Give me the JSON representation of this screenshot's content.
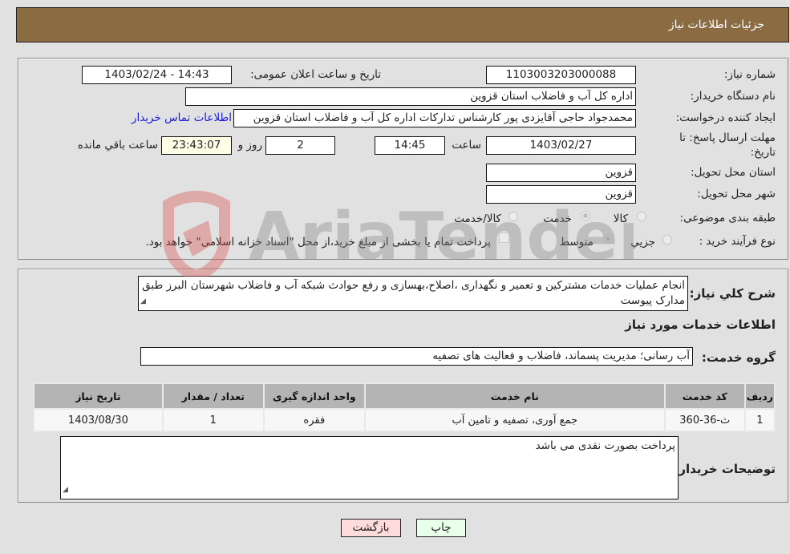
{
  "header": {
    "title": "جزئیات اطلاعات نیاز"
  },
  "details": {
    "need_number_label": "شماره نیاز:",
    "need_number": "1103003203000088",
    "announce_label": "تاریخ و ساعت اعلان عمومی:",
    "announce_value": "1403/02/24 - 14:43",
    "buyer_org_label": "نام دستگاه خریدار:",
    "buyer_org": "اداره کل آب و فاضلاب استان قزوین",
    "requester_label": "ایجاد کننده درخواست:",
    "requester": "محمدجواد حاجی آقایزدی پور کارشناس تدارکات اداره کل آب و فاضلاب استان قزوین",
    "contact_link": "اطلاعات تماس خریدار",
    "deadline_label": "مهلت ارسال پاسخ: تا تاریخ:",
    "deadline_date": "1403/02/27",
    "time_label": "ساعت",
    "deadline_time": "14:45",
    "days_value": "2",
    "days_label": "روز و",
    "remaining_time": "23:43:07",
    "remaining_label": "ساعت باقي مانده",
    "province_label": "استان محل تحویل:",
    "province": "قزوین",
    "city_label": "شهر محل تحویل:",
    "city": "قزوین",
    "category_label": "طبقه بندی موضوعی:",
    "category_options": [
      "کالا",
      "خدمت",
      "کالا/خدمت"
    ],
    "category_selected": "خدمت",
    "process_label": "نوع فرآیند خرید :",
    "process_options": [
      "جزيي",
      "متوسط"
    ],
    "process_selected": "متوسط",
    "treasury_note": "پرداخت تمام یا بخشی از مبلغ خرید،از محل \"اسناد خزانه اسلامی\" خواهد بود."
  },
  "description": {
    "label": "شرح کلي نیاز:",
    "text": "انجام عملیات خدمات مشترکین و تعمیر و نگهداری ،اصلاح،بهسازی و رفع حوادث شبکه آب و فاضلاب شهرستان البرز طبق مدارک پیوست"
  },
  "services": {
    "section_title": "اطلاعات خدمات مورد نیاز",
    "group_label": "گروه خدمت:",
    "group_value": "آب رسانی؛ مدیریت پسماند، فاضلاب و فعالیت های تصفیه",
    "columns": [
      "ردیف",
      "کد خدمت",
      "نام خدمت",
      "واحد اندازه گیری",
      "تعداد / مقدار",
      "تاریخ نیاز"
    ],
    "rows": [
      [
        "1",
        "ث-36-360",
        "جمع آوری، تصفیه و تامین آب",
        "فقره",
        "1",
        "1403/08/30"
      ]
    ]
  },
  "buyer_notes": {
    "label": "توضیحات خریدار:",
    "text": "پرداخت بصورت نقدی می باشد"
  },
  "buttons": {
    "print": "چاپ",
    "back": "بازگشت"
  },
  "watermark": {
    "text": "AriaTender.neT"
  },
  "colors": {
    "header_bg": "#8b6c42",
    "print_bg": "#eaffea",
    "back_bg": "#ffdcdc",
    "link": "#1a1adb"
  }
}
